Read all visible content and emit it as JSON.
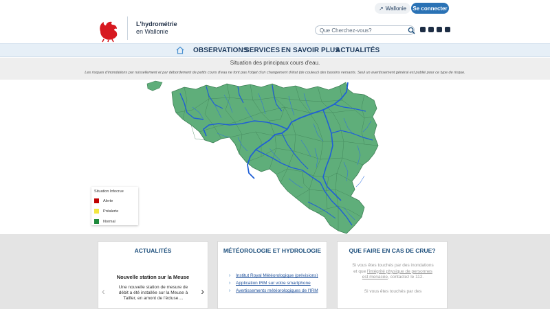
{
  "header": {
    "logo_line1": "L'hydrométrie",
    "logo_line2": "en Wallonie",
    "wallonie_link": "Wallonie",
    "login_button": "Se connecter",
    "search_placeholder": "Que Cherchez-vous?",
    "socials": [
      "instagram-icon",
      "twitter-icon",
      "facebook-icon",
      "youtube-icon"
    ]
  },
  "nav": {
    "items": [
      "OBSERVATIONS",
      "SERVICES",
      "EN SAVOIR PLUS",
      "ACTUALITÉS"
    ]
  },
  "situation": {
    "title": "Situation des principaux cours d'eau.",
    "note": "Les risques d'inondations par ruissellement et par débordement de petits cours d'eau ne font pas l'objet d'un changement d'état (de couleur) des bassins versants. Seul un avertissement général est publié pour ce type de risque."
  },
  "legend": {
    "title": "Situation Infocrue",
    "items": [
      {
        "label": "Alerte",
        "color": "#c00000"
      },
      {
        "label": "Préalerte",
        "color": "#f2e640"
      },
      {
        "label": "Normal",
        "color": "#1e8a3c"
      }
    ]
  },
  "colors": {
    "map_fill": "#5fae7a",
    "river": "#1f5fd6",
    "accent": "#2a72b5"
  },
  "cards": {
    "actualites": {
      "title": "ACTUALITÉS",
      "news_title": "Nouvelle station sur la Meuse",
      "news_body": "Une nouvelle station de mesure de débit a été installée sur la Meuse à Tailfer, en amont de l'écluse...."
    },
    "meteo": {
      "title": "MÉTÉOROLOGIE ET HYDROLOGIE",
      "links": [
        "Institut Royal Météorologique (prévisions)",
        "Application IRM sur votre smartphone",
        "Avertissements météorologiques de l'IRM"
      ]
    },
    "crue": {
      "title": "QUE FAIRE EN CAS DE CRUE?",
      "p1_a": "Si vous êtes touchés par des inondations et que ",
      "p1_link": "l'intégrité physique de personnes est menacée",
      "p1_b": ", contactez le 112.",
      "p2": "Si vous êtes touchés par des"
    }
  }
}
